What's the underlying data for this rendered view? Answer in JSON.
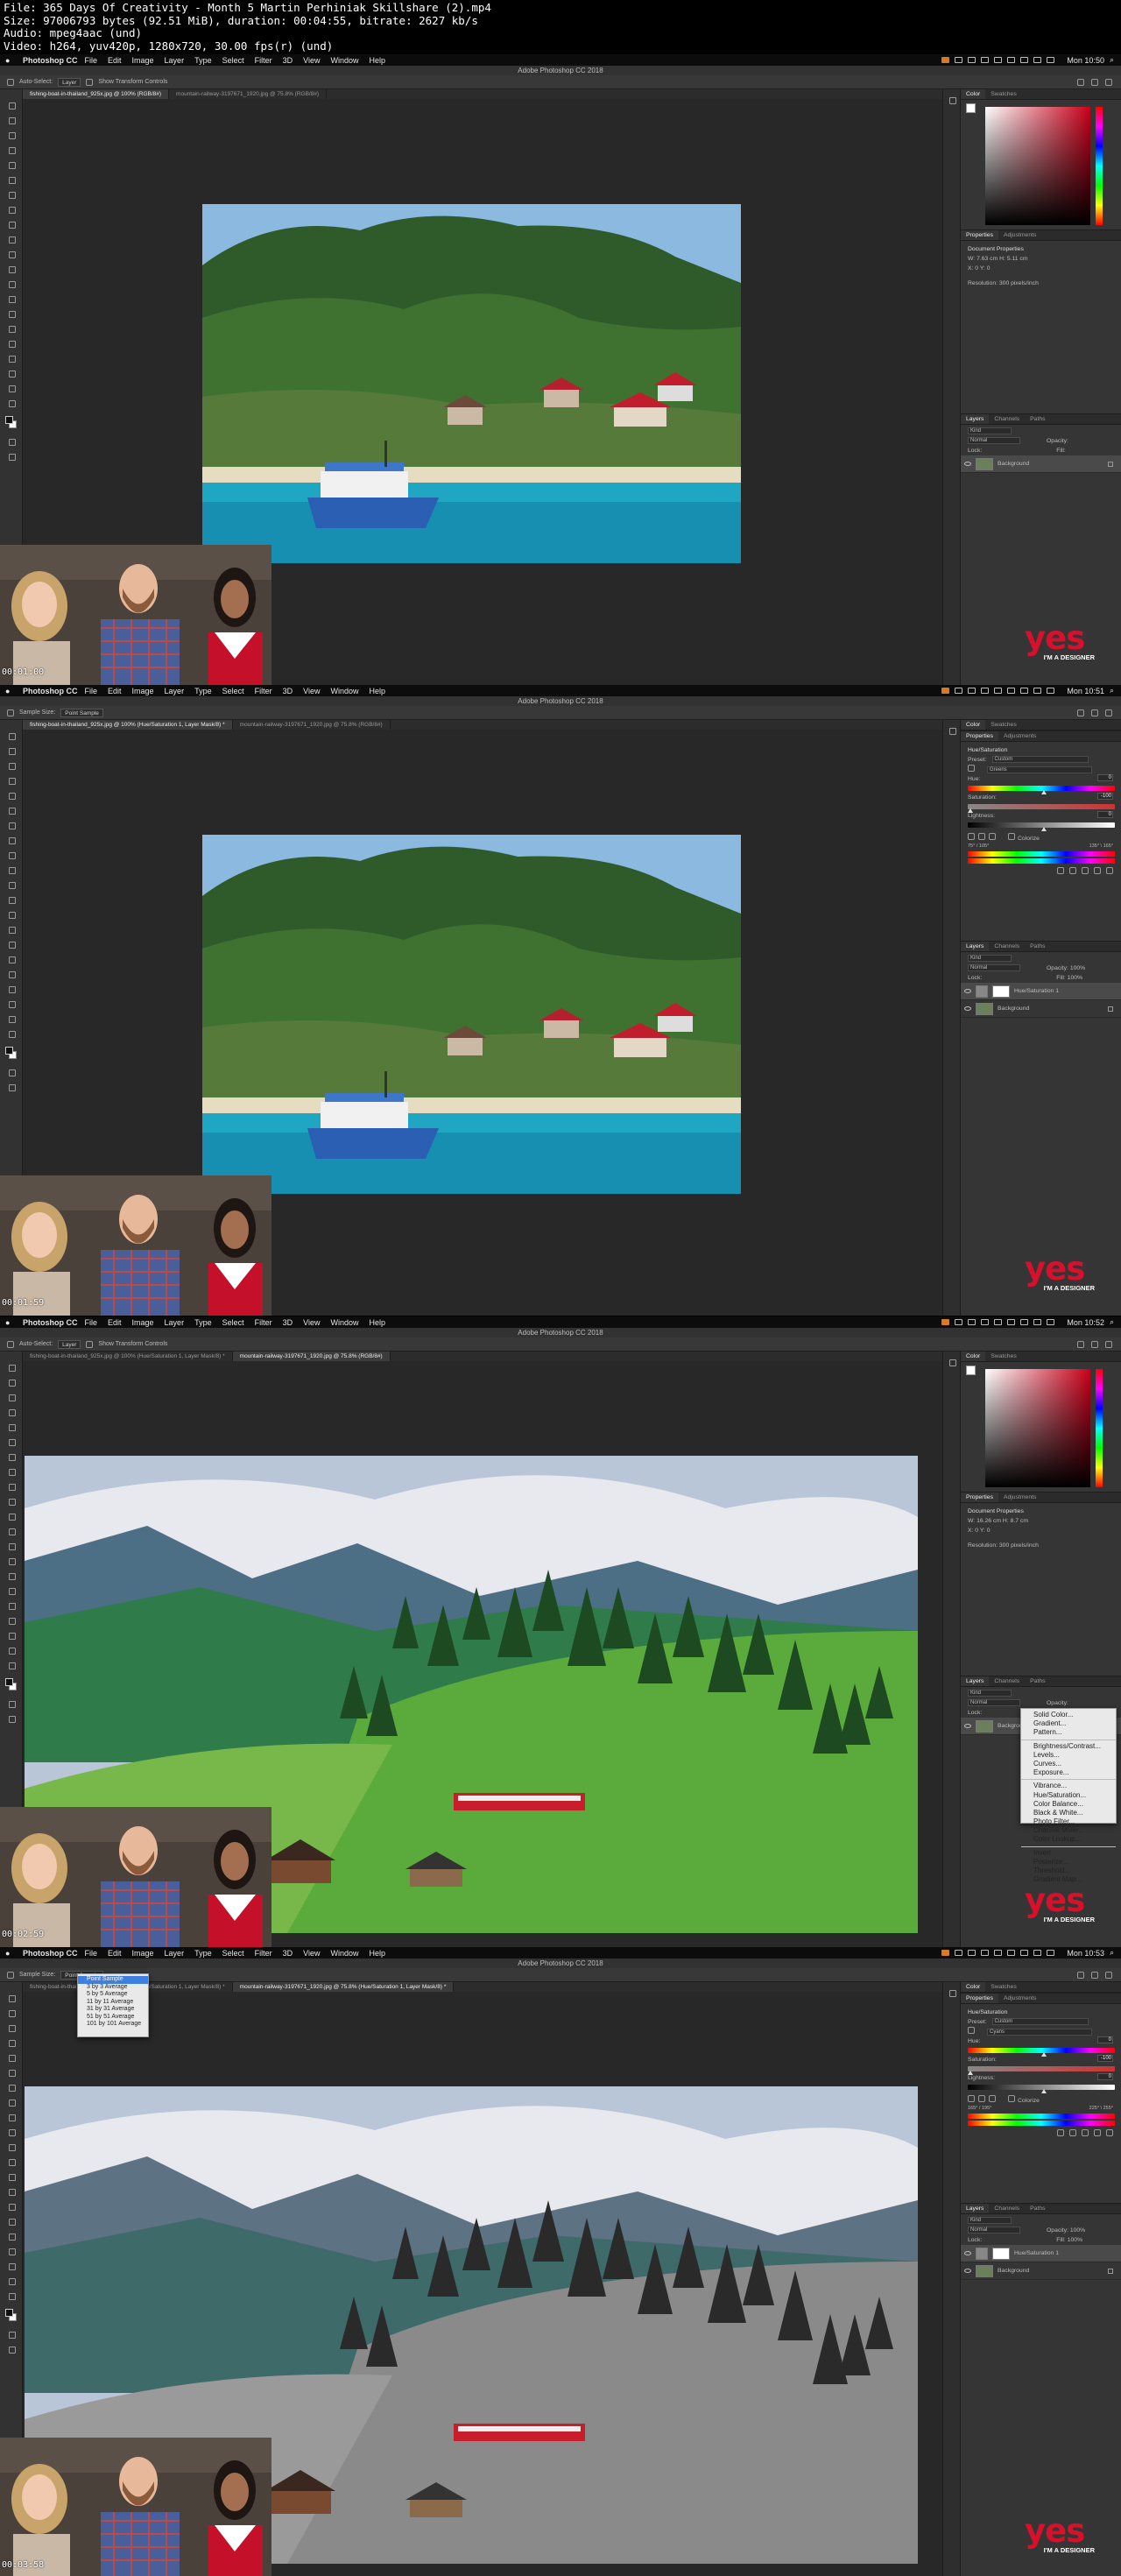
{
  "video_info": {
    "file": "File: 365 Days Of Creativity - Month 5  Martin Perhiniak  Skillshare (2).mp4",
    "size": "Size: 97006793 bytes (92.51 MiB), duration: 00:04:55, bitrate: 2627 kb/s",
    "audio": "Audio: mpeg4aac (und)",
    "video": "Video: h264, yuv420p, 1280x720, 30.00 fps(r) (und)"
  },
  "menubar": {
    "apple": "",
    "app_name": "Photoshop CC",
    "items": [
      "File",
      "Edit",
      "Image",
      "Layer",
      "Type",
      "Select",
      "Filter",
      "3D",
      "View",
      "Window",
      "Help"
    ]
  },
  "ps_title": "Adobe Photoshop CC 2018",
  "logo": {
    "word": "yes",
    "tagline": "I'M A DESIGNER"
  },
  "frames": [
    {
      "clock": "Mon 10:50",
      "timestamp": "00:01:00",
      "options": {
        "tool_label": "Auto-Select:",
        "tool_value": "Layer",
        "extra": "Show Transform Controls"
      },
      "tabs": [
        "fishing-boat-in-thailand_925x.jpg @ 100% (RGB/8#)",
        "mountain-railway-3197671_1920.jpg @ 75.8% (RGB/8#)"
      ],
      "active_tab": 0,
      "panel_top_tabs": [
        "Color",
        "Swatches"
      ],
      "props_tabs": [
        "Properties",
        "Adjustments"
      ],
      "props_title": "Document Properties",
      "props_lines": [
        "W: 7.63 cm        H: 5.11 cm",
        "X: 0               Y: 0",
        "Resolution: 300 pixels/inch"
      ],
      "layers_tabs": [
        "Layers",
        "Channels",
        "Paths"
      ],
      "layers_kind": "Kind",
      "layers_mode": "Normal",
      "layers_opacity": "Opacity:",
      "layers_lock": "Lock:",
      "layers_fill": "Fill:",
      "layers": [
        {
          "name": "Background",
          "type": "image",
          "selected": true
        }
      ]
    },
    {
      "clock": "Mon 10:51",
      "timestamp": "00:01:59",
      "options": {
        "tool_label": "Sample Size:",
        "tool_value": "Point Sample",
        "extra": ""
      },
      "tabs": [
        "fishing-boat-in-thailand_925x.jpg @ 100% (Hue/Saturation 1, Layer Mask/8) *",
        "mountain-railway-3197671_1920.jpg @ 75.8% (RGB/8#)"
      ],
      "active_tab": 0,
      "panel_top_tabs": [
        "Color",
        "Swatches"
      ],
      "props_tabs": [
        "Properties",
        "Adjustments"
      ],
      "props_title": "Hue/Saturation",
      "preset_label": "Preset:",
      "preset_value": "Custom",
      "channel_value": "Greens",
      "hue_label": "Hue:",
      "hue_value": "0",
      "saturation_label": "Saturation:",
      "saturation_value": "-100",
      "lightness_label": "Lightness:",
      "lightness_value": "0",
      "colorize_label": "Colorize",
      "range_left": "75° / 105°",
      "range_right": "135° \\ 165°",
      "layers_tabs": [
        "Layers",
        "Channels",
        "Paths"
      ],
      "layers_kind": "Kind",
      "layers_mode": "Normal",
      "layers_opacity": "Opacity: 100%",
      "layers_lock": "Lock:",
      "layers_fill": "Fill: 100%",
      "layers": [
        {
          "name": "Hue/Saturation 1",
          "type": "adjustment",
          "selected": true
        },
        {
          "name": "Background",
          "type": "image",
          "selected": false
        }
      ]
    },
    {
      "clock": "Mon 10:52",
      "timestamp": "00:02:59",
      "options": {
        "tool_label": "Auto-Select:",
        "tool_value": "Layer",
        "extra": "Show Transform Controls"
      },
      "tabs": [
        "fishing-boat-in-thailand_925x.jpg @ 100% (Hue/Saturation 1, Layer Mask/8) *",
        "mountain-railway-3197671_1920.jpg @ 75.8% (RGB/8#)"
      ],
      "active_tab": 1,
      "panel_top_tabs": [
        "Color",
        "Swatches"
      ],
      "props_tabs": [
        "Properties",
        "Adjustments"
      ],
      "props_title": "Document Properties",
      "props_lines": [
        "W: 16.26 cm        H: 8.7 cm",
        "X: 0               Y: 0",
        "Resolution: 300 pixels/inch"
      ],
      "layers_tabs": [
        "Layers",
        "Channels",
        "Paths"
      ],
      "layers_kind": "Kind",
      "layers_mode": "Normal",
      "layers_opacity": "Opacity:",
      "layers_lock": "Lock:",
      "layers_fill": "Fill:",
      "layers": [
        {
          "name": "Background",
          "type": "image",
          "selected": true
        }
      ],
      "adjustment_menu": [
        "Solid Color...",
        "Gradient...",
        "Pattern...",
        "-",
        "Brightness/Contrast...",
        "Levels...",
        "Curves...",
        "Exposure...",
        "-",
        "Vibrance...",
        "Hue/Saturation...",
        "Color Balance...",
        "Black & White...",
        "Photo Filter...",
        "Channel Mixer...",
        "Color Lookup...",
        "-",
        "Invert",
        "Posterize...",
        "Threshold...",
        "Gradient Map..."
      ]
    },
    {
      "clock": "Mon 10:53",
      "timestamp": "00:03:58",
      "options": {
        "tool_label": "Sample Size:",
        "tool_value": "Point Sample",
        "extra": ""
      },
      "tabs": [
        "fishing-boat-in-thailand_925x.jpg @ 100% (Hue/Saturation 1, Layer Mask/8) *",
        "mountain-railway-3197671_1920.jpg @ 75.8% (Hue/Saturation 1, Layer Mask/8) *"
      ],
      "active_tab": 1,
      "panel_top_tabs": [
        "Color",
        "Swatches"
      ],
      "props_tabs": [
        "Properties",
        "Adjustments"
      ],
      "props_title": "Hue/Saturation",
      "preset_label": "Preset:",
      "preset_value": "Custom",
      "channel_value": "Cyans",
      "hue_label": "Hue:",
      "hue_value": "0",
      "saturation_label": "Saturation:",
      "saturation_value": "-100",
      "lightness_label": "Lightness:",
      "lightness_value": "0",
      "colorize_label": "Colorize",
      "range_left": "165° / 195°",
      "range_right": "225° \\ 255°",
      "layers_tabs": [
        "Layers",
        "Channels",
        "Paths"
      ],
      "layers_kind": "Kind",
      "layers_mode": "Normal",
      "layers_opacity": "Opacity: 100%",
      "layers_lock": "Lock:",
      "layers_fill": "Fill: 100%",
      "layers": [
        {
          "name": "Hue/Saturation 1",
          "type": "adjustment",
          "selected": true
        },
        {
          "name": "Background",
          "type": "image",
          "selected": false
        }
      ],
      "sample_menu": [
        "Point Sample",
        "3 by 3 Average",
        "5 by 5 Average",
        "11 by 11 Average",
        "31 by 31 Average",
        "51 by 51 Average",
        "101 by 101 Average"
      ],
      "sample_menu_selected": 0
    }
  ]
}
